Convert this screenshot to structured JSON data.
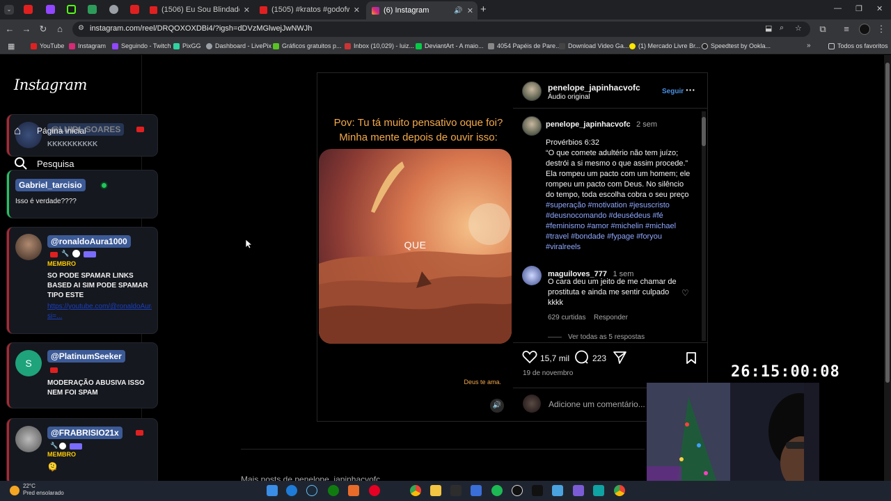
{
  "browser": {
    "tabs": [
      {
        "label": "(1506) Eu Sou Blindado - YouTu"
      },
      {
        "label": "(1505) #kratos #godofwar3 #g"
      },
      {
        "label": "(6) Instagram"
      }
    ],
    "url": "instagram.com/reel/DRQOXOXDBi4/?igsh=dDVzMGlwejJwNWJh",
    "bookmarks": [
      "YouTube",
      "Instagram",
      "Seguindo - Twitch",
      "PixGG",
      "Dashboard - LivePix",
      "Gráficos gratuitos p...",
      "Inbox (10,029) - luiz...",
      "DeviantArt - A maio...",
      "4054 Papéis de Pare...",
      "Download Video Ga...",
      "(1) Mercado Livre Br...",
      "Speedtest by Ookla..."
    ],
    "bookmarks_other": "Todos os favoritos"
  },
  "sidebar": {
    "logo": "Instagram",
    "nav": [
      "Página inicial",
      "Pesquisa"
    ]
  },
  "chat": [
    {
      "name": "@LUIDI_SOARES",
      "message": "KKKKKKKKKK"
    },
    {
      "name": "Gabriel_tarcisio",
      "message": "Isso é verdade????"
    },
    {
      "name": "@ronaldoAura1000",
      "badge": "MEMBRO",
      "message": "SO PODE SPAMAR LINKS BASED AI SIM PODE SPAMAR TIPO ESTE",
      "link": "https://youtube.com/@ronaldoAura1000?si=..."
    },
    {
      "name": "@PlatinumSeeker",
      "avatar_letter": "S",
      "message": "MODERAÇÃO ABUSIVA ISSO NEM FOI SPAM"
    },
    {
      "name": "@FRABRISIO21x",
      "badge": "MEMBRO",
      "message": "🫠"
    }
  ],
  "reel": {
    "title_line1": "Pov: Tu tá muito pensativo oque foi?",
    "title_line2": "Minha mente depois de ouvir isso:",
    "overlay_word": "QUE",
    "caption": "Deus te ama."
  },
  "post": {
    "author": "penelope_japinhacvofc",
    "follow": "Seguir",
    "audio": "Áudio original",
    "description": {
      "author": "penelope_japinhacvofc",
      "time": "2 sem",
      "text": "Provérbios 6:32\n“O que comete adultério não tem juízo; destrói a si mesmo o que assim procede.”\nEla rompeu um pacto com um homem; ele rompeu um pacto com Deus. No silêncio do tempo, toda escolha cobra o seu preço",
      "hashtags": "#superação #motivation #jesuscristo #deusnocomando #deusédeus #fé #feminismo #amor #michelin #michael #travel #bondade #fypage #foryou #viralreels"
    },
    "comment": {
      "author": "maguiloves_777",
      "time": "1 sem",
      "text": "O cara deu um jeito de me chamar de prostituta e ainda me sentir culpado kkkk",
      "likes": "629 curtidas",
      "reply": "Responder",
      "view_replies": "Ver todas as 5 respostas"
    },
    "likes": "15,7 mil",
    "comments_count": "223",
    "date": "19 de novembro",
    "add_comment_placeholder": "Adicione um comentário..."
  },
  "more_from": "Mais posts de penelope_japinhacvofc",
  "stream": {
    "timer": "26:15:00:08"
  },
  "taskbar": {
    "weather_temp": "22°C",
    "weather_desc": "Pred ensolarado"
  }
}
